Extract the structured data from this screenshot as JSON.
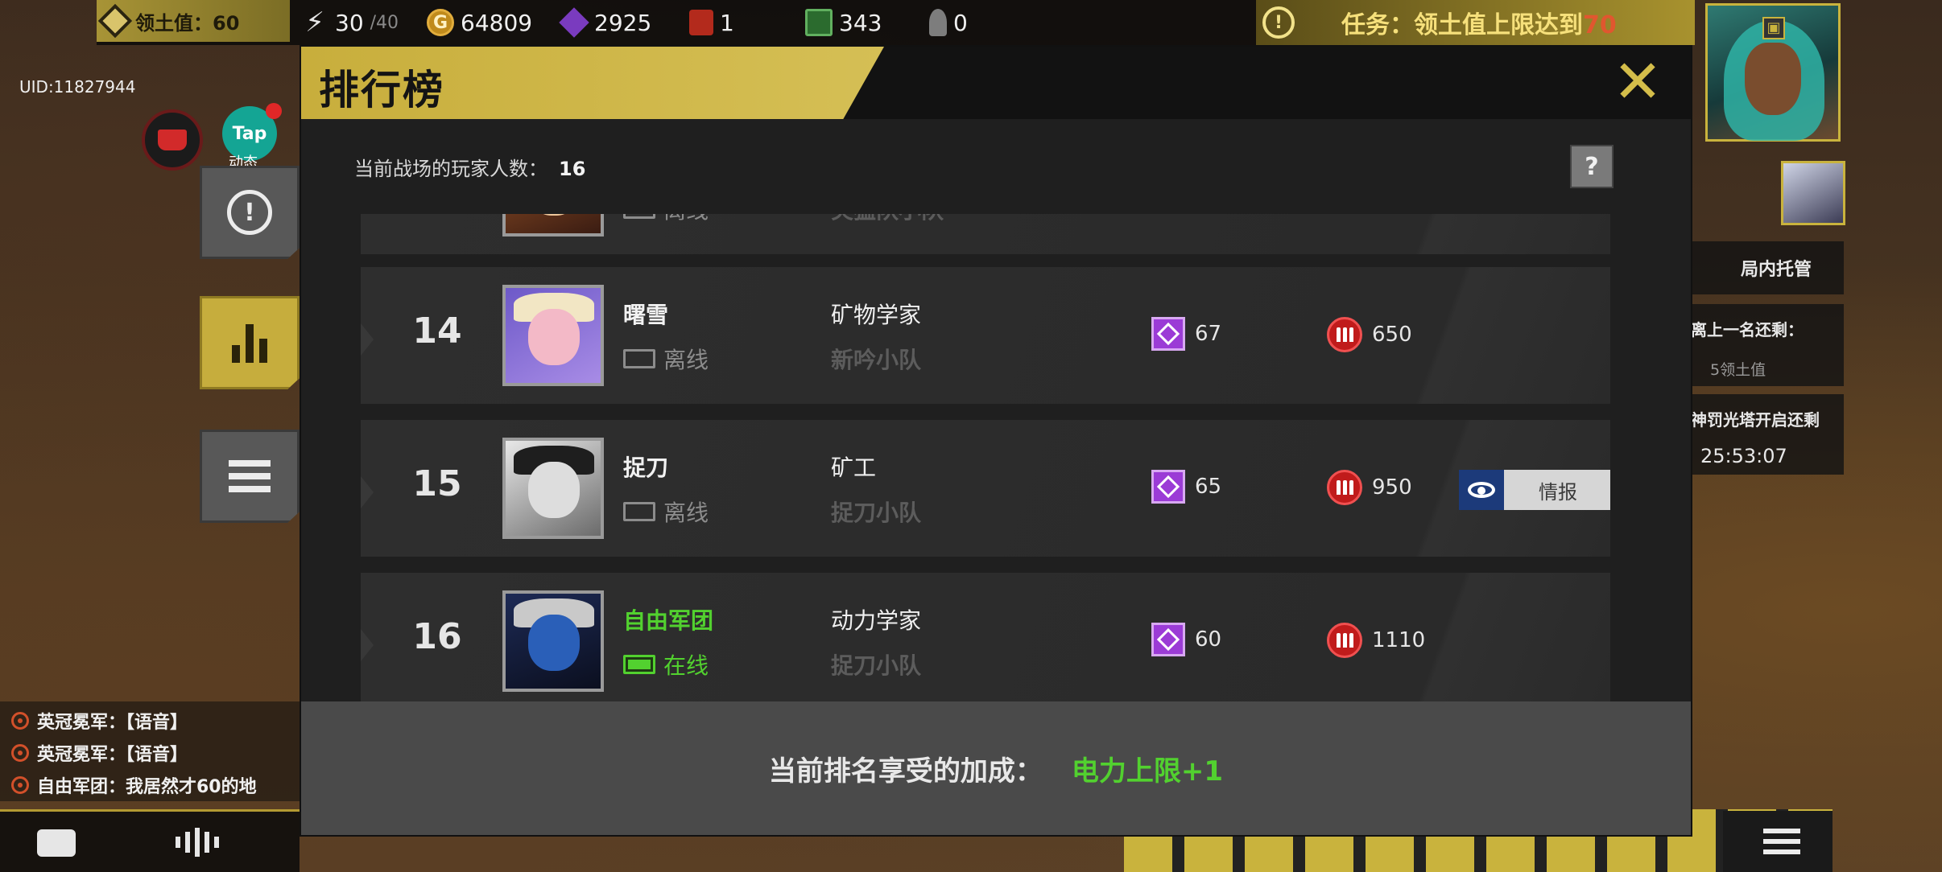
{
  "hud": {
    "territory_label": "领土值：60",
    "energy": "30",
    "energy_max": "/40",
    "gold": "64809",
    "gems": "2925",
    "fuel": "1",
    "chips": "343",
    "shells": "0",
    "quest_prefix": "任务：领土值上限达到",
    "quest_target": "70",
    "uid": "UID:11827944",
    "tap_badge": "Tap",
    "tap_label": "动态",
    "managed_label": "局内托管",
    "next_rank_label": "离上一名还剩：",
    "next_rank_value": "5领土值",
    "tower_label": "神罚光塔开启还剩",
    "tower_timer": "25:53:07",
    "chat": [
      "英冠冕军：【语音】",
      "英冠冕军：【语音】",
      "自由军团：我居然才60的地"
    ]
  },
  "modal": {
    "title": "排行榜",
    "player_count_label": "当前战场的玩家人数：",
    "player_count": "16",
    "help": "?",
    "close": "✕",
    "partial_row": {
      "status": "离线",
      "team": "突猛队小队"
    },
    "rows": [
      {
        "rank": "14",
        "name": "曙雪",
        "online": false,
        "status": "离线",
        "title": "矿物学家",
        "team": "新吟小队",
        "gems": "67",
        "ammo": "650"
      },
      {
        "rank": "15",
        "name": "捉刀",
        "online": false,
        "status": "离线",
        "title": "矿工",
        "team": "捉刀小队",
        "gems": "65",
        "ammo": "950",
        "action": "情报"
      },
      {
        "rank": "16",
        "name": "自由军团",
        "online": true,
        "status": "在线",
        "title": "动力学家",
        "team": "捉刀小队",
        "gems": "60",
        "ammo": "1110"
      }
    ],
    "bonus_label": "当前排名享受的加成：",
    "bonus_value": "电力上限+1"
  },
  "colors": {
    "accent_gold": "#c8ae3c",
    "online_green": "#52d12f",
    "gem_purple": "#9b3bd6",
    "ammo_red": "#c01b1b"
  }
}
